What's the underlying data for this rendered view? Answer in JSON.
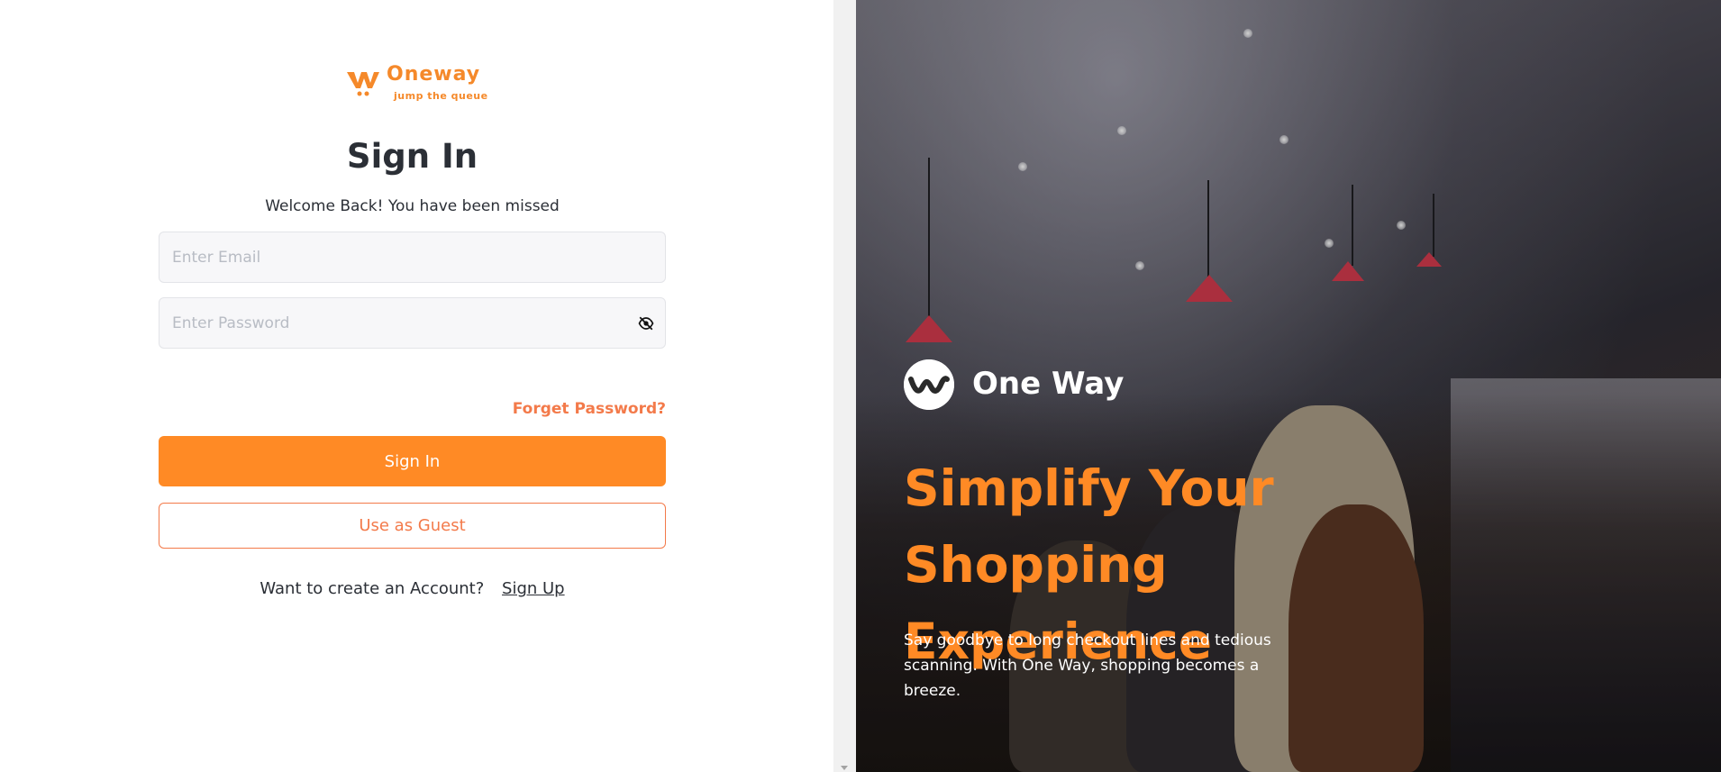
{
  "logo": {
    "name": "Oneway",
    "tagline": "jump the queue",
    "icon": "oneway-logo-icon"
  },
  "signin": {
    "title": "Sign In",
    "subtitle": "Welcome Back! You have been missed",
    "email_placeholder": "Enter Email",
    "password_placeholder": "Enter Password",
    "password_toggle_icon": "eye-off-icon",
    "forgot_label": "Forget Password?",
    "submit_label": "Sign In",
    "guest_label": "Use as Guest",
    "signup_prompt": "Want to create an Account?",
    "signup_link": "Sign Up"
  },
  "hero": {
    "brand_name": "One Way",
    "brand_icon": "one-way-logo-icon",
    "headline": "Simplify Your Shopping Experience",
    "description": "Say goodbye to long checkout lines and tedious scanning. With One Way, shopping becomes a breeze."
  },
  "colors": {
    "accent": "#ff8a25",
    "accent_outline": "#f37a4a",
    "text_dark": "#2b2f36",
    "field_bg": "#f7f7f9"
  }
}
